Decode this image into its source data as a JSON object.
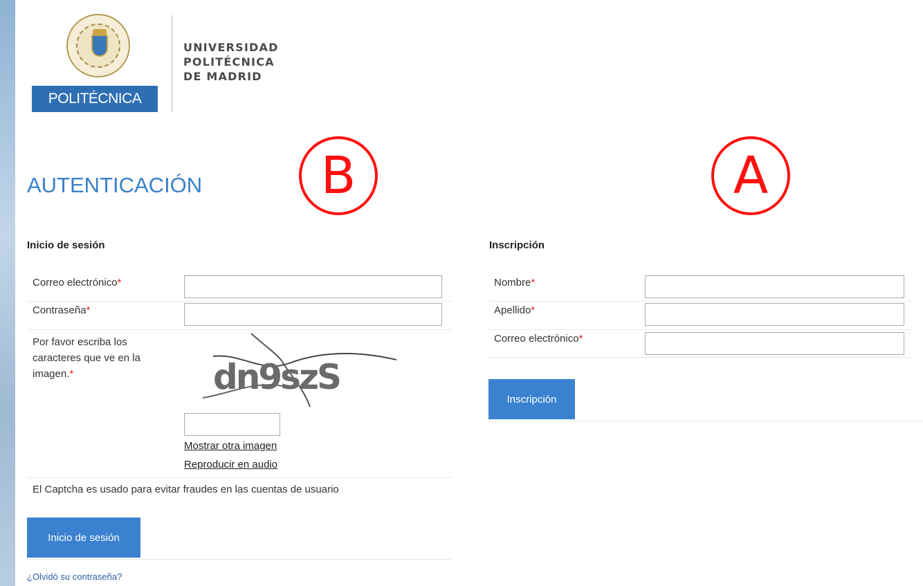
{
  "header": {
    "logo_wordmark": "POLITÉCNICA",
    "university_lines": [
      "UNIVERSIDAD",
      "POLITÉCNICA",
      "DE MADRID"
    ]
  },
  "markers": {
    "left": "B",
    "right": "A"
  },
  "page_title": "AUTENTICACIÓN",
  "login": {
    "heading": "Inicio de sesión",
    "email_label": "Correo electrónico",
    "password_label": "Contraseña",
    "required_mark": "*",
    "captcha_label": "Por favor escriba los caracteres que ve en la imagen.",
    "captcha_text": "dn9szS",
    "show_other_image": "Mostrar otra imagen",
    "play_audio": "Reproducir en audio",
    "captcha_note": "El Captcha es usado para evitar fraudes en las cuentas de usuario",
    "submit_label": "Inicio de sesión",
    "forgot_password": "¿Olvidó su contraseña?"
  },
  "registration": {
    "heading": "Inscripción",
    "first_name_label": "Nombre",
    "last_name_label": "Apellido",
    "email_label": "Correo electrónico",
    "required_mark": "*",
    "submit_label": "Inscripción"
  },
  "colors": {
    "accent": "#3a82cf",
    "title": "#3a80c9",
    "marker": "#ff1010",
    "required": "#d42424"
  }
}
